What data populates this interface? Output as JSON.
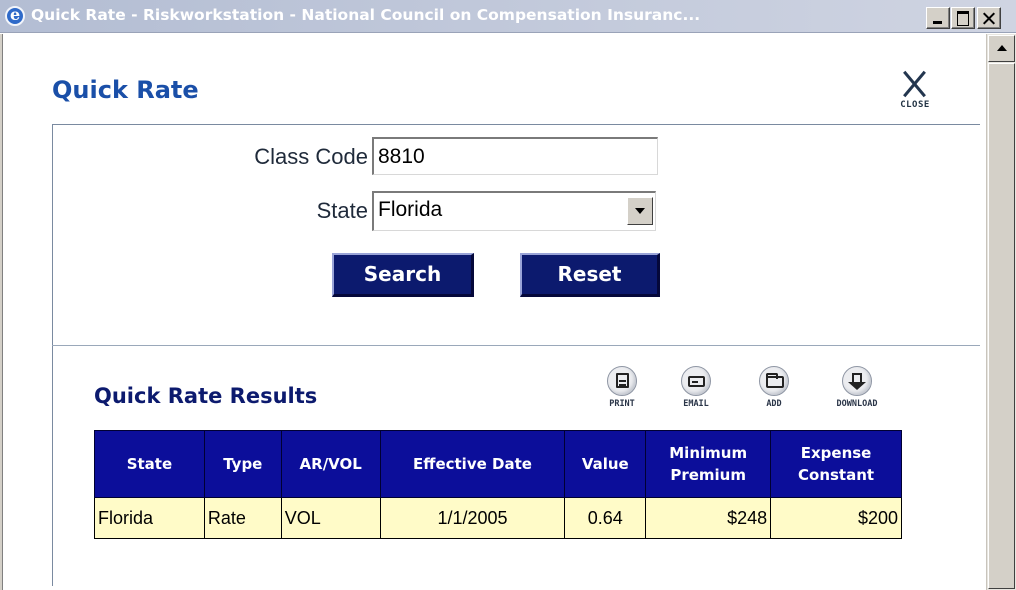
{
  "window": {
    "title": "Quick Rate - Riskworkstation - National Council on Compensation Insuranc...",
    "icon": "ie-icon"
  },
  "header": {
    "title": "Quick Rate",
    "close_label": "CLOSE"
  },
  "form": {
    "class_code_label": "Class Code",
    "class_code_value": "8810",
    "state_label": "State",
    "state_value": "Florida",
    "search_label": "Search",
    "reset_label": "Reset"
  },
  "results": {
    "title": "Quick Rate Results",
    "tools": {
      "print": "PRINT",
      "email": "EMAIL",
      "add": "ADD",
      "download": "DOWNLOAD"
    },
    "columns": {
      "state": "State",
      "type": "Type",
      "arvol": "AR/VOL",
      "effective_date": "Effective Date",
      "value": "Value",
      "minimum_premium_1": "Minimum",
      "minimum_premium_2": "Premium",
      "expense_constant_1": "Expense",
      "expense_constant_2": "Constant"
    },
    "rows": [
      {
        "state": "Florida",
        "type": "Rate",
        "arvol": "VOL",
        "effective_date": "1/1/2005",
        "value": "0.64",
        "minimum_premium": "$248",
        "expense_constant": "$200"
      }
    ]
  },
  "colors": {
    "title_blue": "#1a4fa8",
    "button_navy": "#0c1a6e",
    "table_header": "#0c0e9a",
    "row_background": "#fffbc8"
  }
}
